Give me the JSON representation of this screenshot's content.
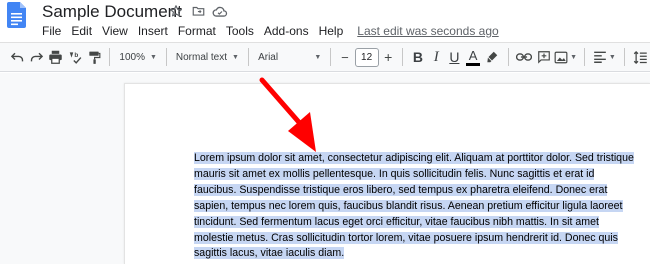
{
  "app": {
    "title": "Sample Document",
    "icons": [
      "star-icon",
      "move-to-folder-icon",
      "cloud-status-icon"
    ]
  },
  "menu": {
    "items": [
      "File",
      "Edit",
      "View",
      "Insert",
      "Format",
      "Tools",
      "Add-ons",
      "Help"
    ],
    "last_edit": "Last edit was seconds ago"
  },
  "toolbar": {
    "zoom": "100%",
    "style": "Normal text",
    "font": "Arial",
    "font_size": "12",
    "minus": "−",
    "plus": "+",
    "bold": "B",
    "italic": "I",
    "underline": "U",
    "text_color": "A",
    "text_color_value": "#000000"
  },
  "document": {
    "paragraph": "Lorem ipsum dolor sit amet, consectetur adipiscing elit. Aliquam at porttitor dolor. Sed tristique mauris sit amet ex mollis pellentesque. In quis sollicitudin felis. Nunc sagittis et erat id faucibus. Suspendisse tristique eros libero, sed tempus ex pharetra eleifend. Donec erat sapien, tempus nec lorem quis, faucibus blandit risus. Aenean pretium efficitur ligula laoreet tincidunt. Sed fermentum lacus eget orci efficitur, vitae faucibus nibh mattis. In sit amet molestie metus. Cras sollicitudin tortor lorem, vitae posuere ipsum hendrerit id. Donec quis sagittis lacus, vitae iaculis diam.",
    "selected": true,
    "selection_color": "#c6d6f3"
  },
  "annotation": {
    "color": "#ff0000"
  }
}
